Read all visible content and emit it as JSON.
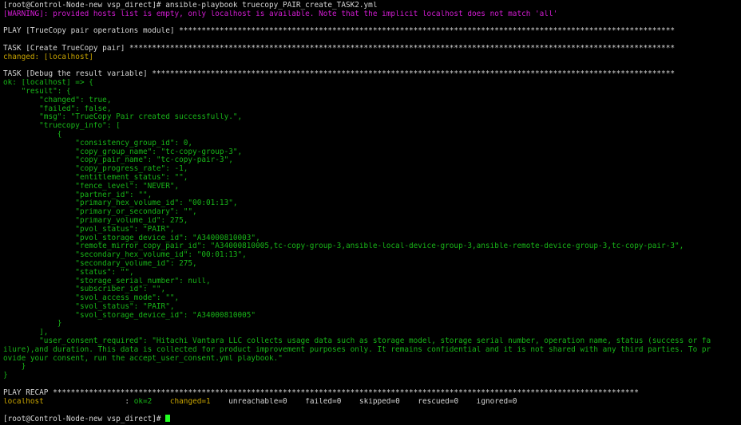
{
  "terminal": {
    "lines": [
      [
        {
          "t": "[root@Control-Node-new vsp_direct]# ansible-playbook truecopy_PAIR_create_TASK2.yml",
          "c": "white"
        }
      ],
      [
        {
          "t": "[WARNING]: provided hosts list is empty, only localhost is available. Note that the implicit localhost does not match 'all'",
          "c": "magenta"
        }
      ],
      [],
      [
        {
          "t": "PLAY [TrueCopy pair operations module] **************************************************************************************************************",
          "c": "white"
        }
      ],
      [],
      [
        {
          "t": "TASK [Create TrueCopy pair] *************************************************************************************************************************",
          "c": "white"
        }
      ],
      [
        {
          "t": "changed: [localhost]",
          "c": "yellow"
        }
      ],
      [],
      [
        {
          "t": "TASK [Debug the result variable] ********************************************************************************************************************",
          "c": "white"
        }
      ],
      [
        {
          "t": "ok: [localhost] => {",
          "c": "green"
        }
      ],
      [
        {
          "t": "    \"result\": {",
          "c": "green"
        }
      ],
      [
        {
          "t": "        \"changed\": true,",
          "c": "green"
        }
      ],
      [
        {
          "t": "        \"failed\": false,",
          "c": "green"
        }
      ],
      [
        {
          "t": "        \"msg\": \"TrueCopy Pair created successfully.\",",
          "c": "green"
        }
      ],
      [
        {
          "t": "        \"truecopy_info\": [",
          "c": "green"
        }
      ],
      [
        {
          "t": "            {",
          "c": "green"
        }
      ],
      [
        {
          "t": "                \"consistency_group_id\": 0,",
          "c": "green"
        }
      ],
      [
        {
          "t": "                \"copy_group_name\": \"tc-copy-group-3\",",
          "c": "green"
        }
      ],
      [
        {
          "t": "                \"copy_pair_name\": \"tc-copy-pair-3\",",
          "c": "green"
        }
      ],
      [
        {
          "t": "                \"copy_progress_rate\": -1,",
          "c": "green"
        }
      ],
      [
        {
          "t": "                \"entitlement_status\": \"\",",
          "c": "green"
        }
      ],
      [
        {
          "t": "                \"fence_level\": \"NEVER\",",
          "c": "green"
        }
      ],
      [
        {
          "t": "                \"partner_id\": \"\",",
          "c": "green"
        }
      ],
      [
        {
          "t": "                \"primary_hex_volume_id\": \"00:01:13\",",
          "c": "green"
        }
      ],
      [
        {
          "t": "                \"primary_or_secondary\": \"\",",
          "c": "green"
        }
      ],
      [
        {
          "t": "                \"primary_volume_id\": 275,",
          "c": "green"
        }
      ],
      [
        {
          "t": "                \"pvol_status\": \"PAIR\",",
          "c": "green"
        }
      ],
      [
        {
          "t": "                \"pvol_storage_device_id\": \"A34000810003\",",
          "c": "green"
        }
      ],
      [
        {
          "t": "                \"remote_mirror_copy_pair_id\": \"A34000810005,tc-copy-group-3,ansible-local-device-group-3,ansible-remote-device-group-3,tc-copy-pair-3\",",
          "c": "green"
        }
      ],
      [
        {
          "t": "                \"secondary_hex_volume_id\": \"00:01:13\",",
          "c": "green"
        }
      ],
      [
        {
          "t": "                \"secondary_volume_id\": 275,",
          "c": "green"
        }
      ],
      [
        {
          "t": "                \"status\": \"\",",
          "c": "green"
        }
      ],
      [
        {
          "t": "                \"storage_serial_number\": null,",
          "c": "green"
        }
      ],
      [
        {
          "t": "                \"subscriber_id\": \"\",",
          "c": "green"
        }
      ],
      [
        {
          "t": "                \"svol_access_mode\": \"\",",
          "c": "green"
        }
      ],
      [
        {
          "t": "                \"svol_status\": \"PAIR\",",
          "c": "green"
        }
      ],
      [
        {
          "t": "                \"svol_storage_device_id\": \"A34000810005\"",
          "c": "green"
        }
      ],
      [
        {
          "t": "            }",
          "c": "green"
        }
      ],
      [
        {
          "t": "        ],",
          "c": "green"
        }
      ],
      [
        {
          "t": "        \"user_consent_required\": \"Hitachi Vantara LLC collects usage data such as storage model, storage serial number, operation name, status (success or fa",
          "c": "green"
        }
      ],
      [
        {
          "t": "ilure),and duration. This data is collected for product improvement purposes only. It remains confidential and it is not shared with any third parties. To pr",
          "c": "green"
        }
      ],
      [
        {
          "t": "ovide your consent, run the accept_user_consent.yml playbook.\"",
          "c": "green"
        }
      ],
      [
        {
          "t": "    }",
          "c": "green"
        }
      ],
      [
        {
          "t": "}",
          "c": "green"
        }
      ],
      [],
      [
        {
          "t": "PLAY RECAP **********************************************************************************************************************************",
          "c": "white"
        }
      ],
      [
        {
          "t": "localhost                  ",
          "c": "yellow"
        },
        {
          "t": ": ",
          "c": "white"
        },
        {
          "t": "ok=2   ",
          "c": "green"
        },
        {
          "t": " changed=1",
          "c": "yellow"
        },
        {
          "t": "    unreachable=0    failed=0    skipped=0    rescued=0    ignored=0",
          "c": "white"
        }
      ],
      [],
      [
        {
          "t": "[root@Control-Node-new vsp_direct]# ",
          "c": "white"
        },
        {
          "t": "",
          "c": "cursor"
        }
      ]
    ]
  }
}
